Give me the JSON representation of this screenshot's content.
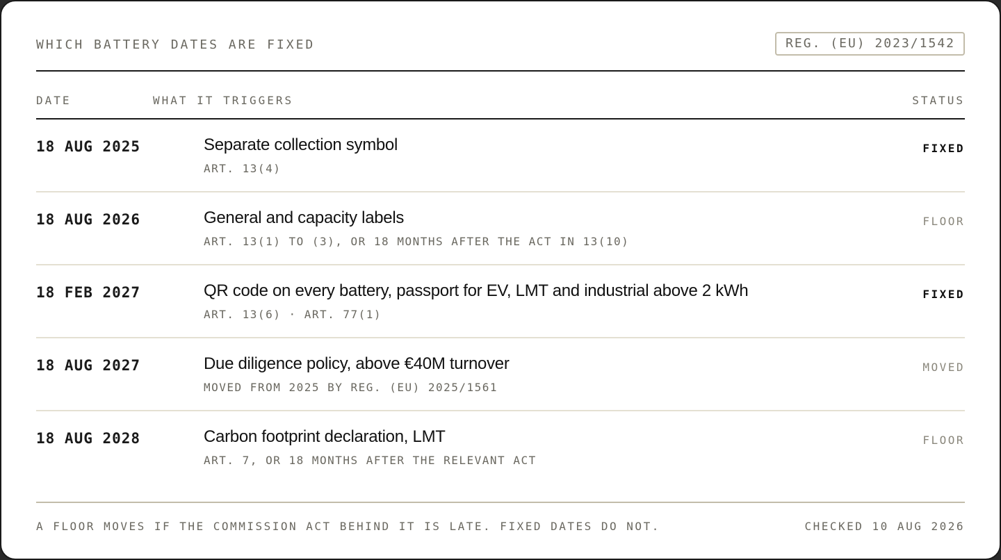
{
  "header": {
    "title": "WHICH BATTERY DATES ARE FIXED",
    "regulation": "REG. (EU) 2023/1542"
  },
  "columns": {
    "date": "DATE",
    "what": "WHAT IT TRIGGERS",
    "status": "STATUS"
  },
  "rows": [
    {
      "date": "18 AUG 2025",
      "title": "Separate collection symbol",
      "ref": "ART. 13(4)",
      "status": "FIXED"
    },
    {
      "date": "18 AUG 2026",
      "title": "General and capacity labels",
      "ref": "ART. 13(1) TO (3), OR 18 MONTHS AFTER THE ACT IN 13(10)",
      "status": "FLOOR"
    },
    {
      "date": "18 FEB 2027",
      "title": "QR code on every battery, passport for EV, LMT and industrial above 2 kWh",
      "ref": "ART. 13(6) · ART. 77(1)",
      "status": "FIXED"
    },
    {
      "date": "18 AUG 2027",
      "title": "Due diligence policy, above €40M turnover",
      "ref": "MOVED FROM 2025 BY REG. (EU) 2025/1561",
      "status": "MOVED"
    },
    {
      "date": "18 AUG 2028",
      "title": "Carbon footprint declaration, LMT",
      "ref": "ART. 7, OR 18 MONTHS AFTER THE RELEVANT ACT",
      "status": "FLOOR"
    }
  ],
  "footer": {
    "note": "A FLOOR MOVES IF THE COMMISSION ACT BEHIND IT IS LATE. FIXED DATES DO NOT.",
    "checked": "CHECKED 10 AUG 2026"
  },
  "colors": {
    "text": "#111111",
    "muted": "#6a6860",
    "rule": "#1a1a1a",
    "divider": "#e4e0d2",
    "badge_border": "#c2bcaa"
  }
}
